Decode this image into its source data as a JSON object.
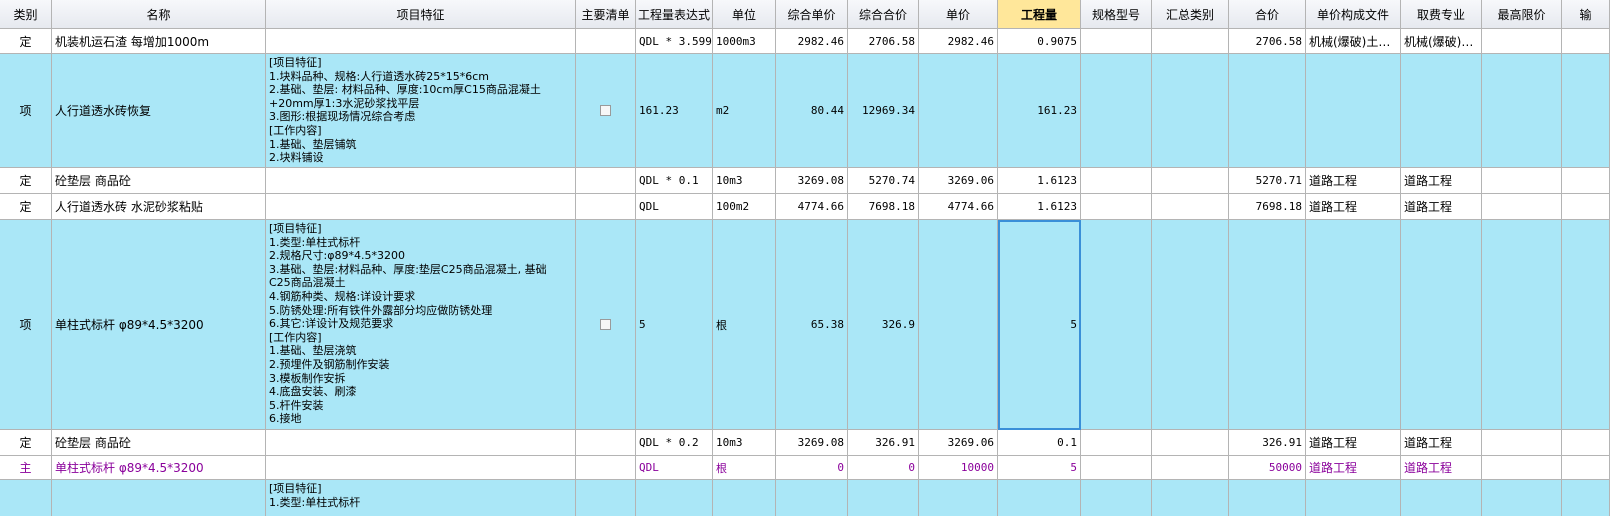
{
  "headers": [
    "类别",
    "名称",
    "项目特征",
    "主要清单",
    "工程量表达式",
    "单位",
    "综合单价",
    "综合合价",
    "单价",
    "工程量",
    "规格型号",
    "汇总类别",
    "合价",
    "单价构成文件",
    "取费专业",
    "最高限价",
    "输"
  ],
  "rows": [
    {
      "type": "定",
      "name": "机装机运石渣 每增加1000m",
      "feature": "",
      "main": false,
      "expr": "QDL * 3.599",
      "unit": "1000m3",
      "zhdj": "2982.46",
      "zhhj": "2706.58",
      "dj": "2982.46",
      "gcl": "0.9075",
      "gg": "",
      "hz": "",
      "hj": "2706.58",
      "djgc": "机械(爆破)土…",
      "qf": "机械(爆破)…",
      "zg": ""
    },
    {
      "type": "项",
      "name": "人行道透水砖恢复",
      "feature": "[项目特征]\n1.块料品种、规格:人行道透水砖25*15*6cm\n2.基础、垫层: 材料品种、厚度:10cm厚C15商品混凝土\n+20mm厚1:3水泥砂浆找平层\n3.图形:根据现场情况综合考虑\n[工作内容]\n1.基础、垫层铺筑\n2.块料铺设",
      "main": true,
      "expr": "161.23",
      "unit": "m2",
      "zhdj": "80.44",
      "zhhj": "12969.34",
      "dj": "",
      "gcl": "161.23",
      "gg": "",
      "hz": "",
      "hj": "",
      "djgc": "",
      "qf": "",
      "zg": ""
    },
    {
      "type": "定",
      "name": "砼垫层 商品砼",
      "feature": "",
      "main": false,
      "expr": "QDL * 0.1",
      "unit": "10m3",
      "zhdj": "3269.08",
      "zhhj": "5270.74",
      "dj": "3269.06",
      "gcl": "1.6123",
      "gg": "",
      "hz": "",
      "hj": "5270.71",
      "djgc": "道路工程",
      "qf": "道路工程",
      "zg": ""
    },
    {
      "type": "定",
      "name": "人行道透水砖 水泥砂浆粘贴",
      "feature": "",
      "main": false,
      "expr": "QDL",
      "unit": "100m2",
      "zhdj": "4774.66",
      "zhhj": "7698.18",
      "dj": "4774.66",
      "gcl": "1.6123",
      "gg": "",
      "hz": "",
      "hj": "7698.18",
      "djgc": "道路工程",
      "qf": "道路工程",
      "zg": ""
    },
    {
      "type": "项",
      "name": "单柱式标杆 φ89*4.5*3200",
      "feature": "[项目特征]\n1.类型:单柱式标杆\n2.规格尺寸:φ89*4.5*3200\n3.基础、垫层:材料品种、厚度:垫层C25商品混凝土, 基础\nC25商品混凝土\n4.钢筋种类、规格:详设计要求\n5.防锈处理:所有铁件外露部分均应做防锈处理\n6.其它:详设计及规范要求\n[工作内容]\n1.基础、垫层浇筑\n2.预埋件及钢筋制作安装\n3.模板制作安拆\n4.底盘安装、刷漆\n5.杆件安装\n6.接地",
      "main": true,
      "expr": "5",
      "unit": "根",
      "zhdj": "65.38",
      "zhhj": "326.9",
      "dj": "",
      "gcl": "5",
      "gg": "",
      "hz": "",
      "hj": "",
      "djgc": "",
      "qf": "",
      "zg": ""
    },
    {
      "type": "定",
      "name": "砼垫层 商品砼",
      "feature": "",
      "main": false,
      "expr": "QDL * 0.2",
      "unit": "10m3",
      "zhdj": "3269.08",
      "zhhj": "326.91",
      "dj": "3269.06",
      "gcl": "0.1",
      "gg": "",
      "hz": "",
      "hj": "326.91",
      "djgc": "道路工程",
      "qf": "道路工程",
      "zg": ""
    },
    {
      "type": "主",
      "name": "单柱式标杆 φ89*4.5*3200",
      "feature": "",
      "main": false,
      "expr": "QDL",
      "unit": "根",
      "zhdj": "0",
      "zhhj": "0",
      "dj": "10000",
      "gcl": "5",
      "gg": "",
      "hz": "",
      "hj": "50000",
      "djgc": "道路工程",
      "qf": "道路工程",
      "zg": ""
    },
    {
      "type": "",
      "name": "",
      "feature": "[项目特征]\n1.类型:单柱式标杆",
      "main": false,
      "expr": "",
      "unit": "",
      "zhdj": "",
      "zhhj": "",
      "dj": "",
      "gcl": "",
      "gg": "",
      "hz": "",
      "hj": "",
      "djgc": "",
      "qf": "",
      "zg": ""
    }
  ]
}
